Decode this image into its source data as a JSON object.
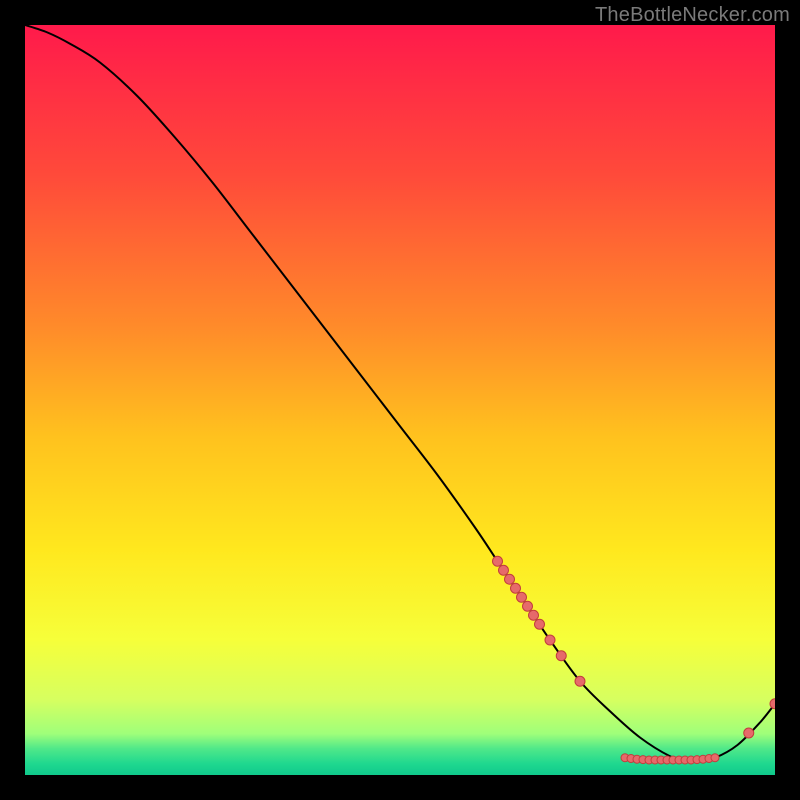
{
  "attribution": "TheBottleNecker.com",
  "colors": {
    "background": "#000000",
    "curve": "#000000",
    "marker_fill": "#e66a6a",
    "marker_stroke": "#c23d3d",
    "gradient_stops": [
      {
        "offset": 0.0,
        "color": "#ff1a4b"
      },
      {
        "offset": 0.2,
        "color": "#ff4a3a"
      },
      {
        "offset": 0.4,
        "color": "#ff8a2a"
      },
      {
        "offset": 0.55,
        "color": "#ffc21e"
      },
      {
        "offset": 0.7,
        "color": "#ffe81e"
      },
      {
        "offset": 0.82,
        "color": "#f6ff3a"
      },
      {
        "offset": 0.9,
        "color": "#d6ff60"
      },
      {
        "offset": 0.945,
        "color": "#9fff7a"
      },
      {
        "offset": 0.965,
        "color": "#4fe889"
      },
      {
        "offset": 0.985,
        "color": "#1fd88f"
      },
      {
        "offset": 1.0,
        "color": "#10c98c"
      }
    ]
  },
  "chart_data": {
    "type": "line",
    "title": "",
    "xlabel": "",
    "ylabel": "",
    "xlim": [
      0,
      100
    ],
    "ylim": [
      0,
      100
    ],
    "series": [
      {
        "name": "bottleneck-curve",
        "x": [
          0,
          3,
          6,
          10,
          15,
          20,
          25,
          30,
          35,
          40,
          45,
          50,
          55,
          60,
          63,
          66,
          70,
          74,
          78,
          82,
          86,
          88,
          90,
          92,
          95,
          98,
          100
        ],
        "y": [
          100,
          99,
          97.5,
          95,
          90.5,
          85,
          79,
          72.5,
          66,
          59.5,
          53,
          46.5,
          40,
          33,
          28.5,
          24,
          18,
          12.5,
          8.5,
          5,
          2.5,
          2,
          2,
          2.3,
          4,
          7,
          9.5
        ]
      }
    ],
    "markers": [
      {
        "x": 63.0,
        "y": 28.5,
        "r": 5
      },
      {
        "x": 63.8,
        "y": 27.3,
        "r": 5
      },
      {
        "x": 64.6,
        "y": 26.1,
        "r": 5
      },
      {
        "x": 65.4,
        "y": 24.9,
        "r": 5
      },
      {
        "x": 66.2,
        "y": 23.7,
        "r": 5
      },
      {
        "x": 67.0,
        "y": 22.5,
        "r": 5
      },
      {
        "x": 67.8,
        "y": 21.3,
        "r": 5
      },
      {
        "x": 68.6,
        "y": 20.1,
        "r": 5
      },
      {
        "x": 70.0,
        "y": 18.0,
        "r": 5
      },
      {
        "x": 71.5,
        "y": 15.9,
        "r": 5
      },
      {
        "x": 74.0,
        "y": 12.5,
        "r": 5
      },
      {
        "x": 80.0,
        "y": 2.3,
        "r": 4
      },
      {
        "x": 80.8,
        "y": 2.2,
        "r": 4
      },
      {
        "x": 81.6,
        "y": 2.1,
        "r": 4
      },
      {
        "x": 82.4,
        "y": 2.05,
        "r": 4
      },
      {
        "x": 83.2,
        "y": 2.0,
        "r": 4
      },
      {
        "x": 84.0,
        "y": 2.0,
        "r": 4
      },
      {
        "x": 84.8,
        "y": 2.0,
        "r": 4
      },
      {
        "x": 85.6,
        "y": 2.0,
        "r": 4
      },
      {
        "x": 86.4,
        "y": 2.0,
        "r": 4
      },
      {
        "x": 87.2,
        "y": 2.0,
        "r": 4
      },
      {
        "x": 88.0,
        "y": 2.0,
        "r": 4
      },
      {
        "x": 88.8,
        "y": 2.0,
        "r": 4
      },
      {
        "x": 89.6,
        "y": 2.05,
        "r": 4
      },
      {
        "x": 90.4,
        "y": 2.1,
        "r": 4
      },
      {
        "x": 91.2,
        "y": 2.2,
        "r": 4
      },
      {
        "x": 92.0,
        "y": 2.3,
        "r": 4
      },
      {
        "x": 96.5,
        "y": 5.6,
        "r": 5
      },
      {
        "x": 100.0,
        "y": 9.5,
        "r": 5
      }
    ]
  }
}
